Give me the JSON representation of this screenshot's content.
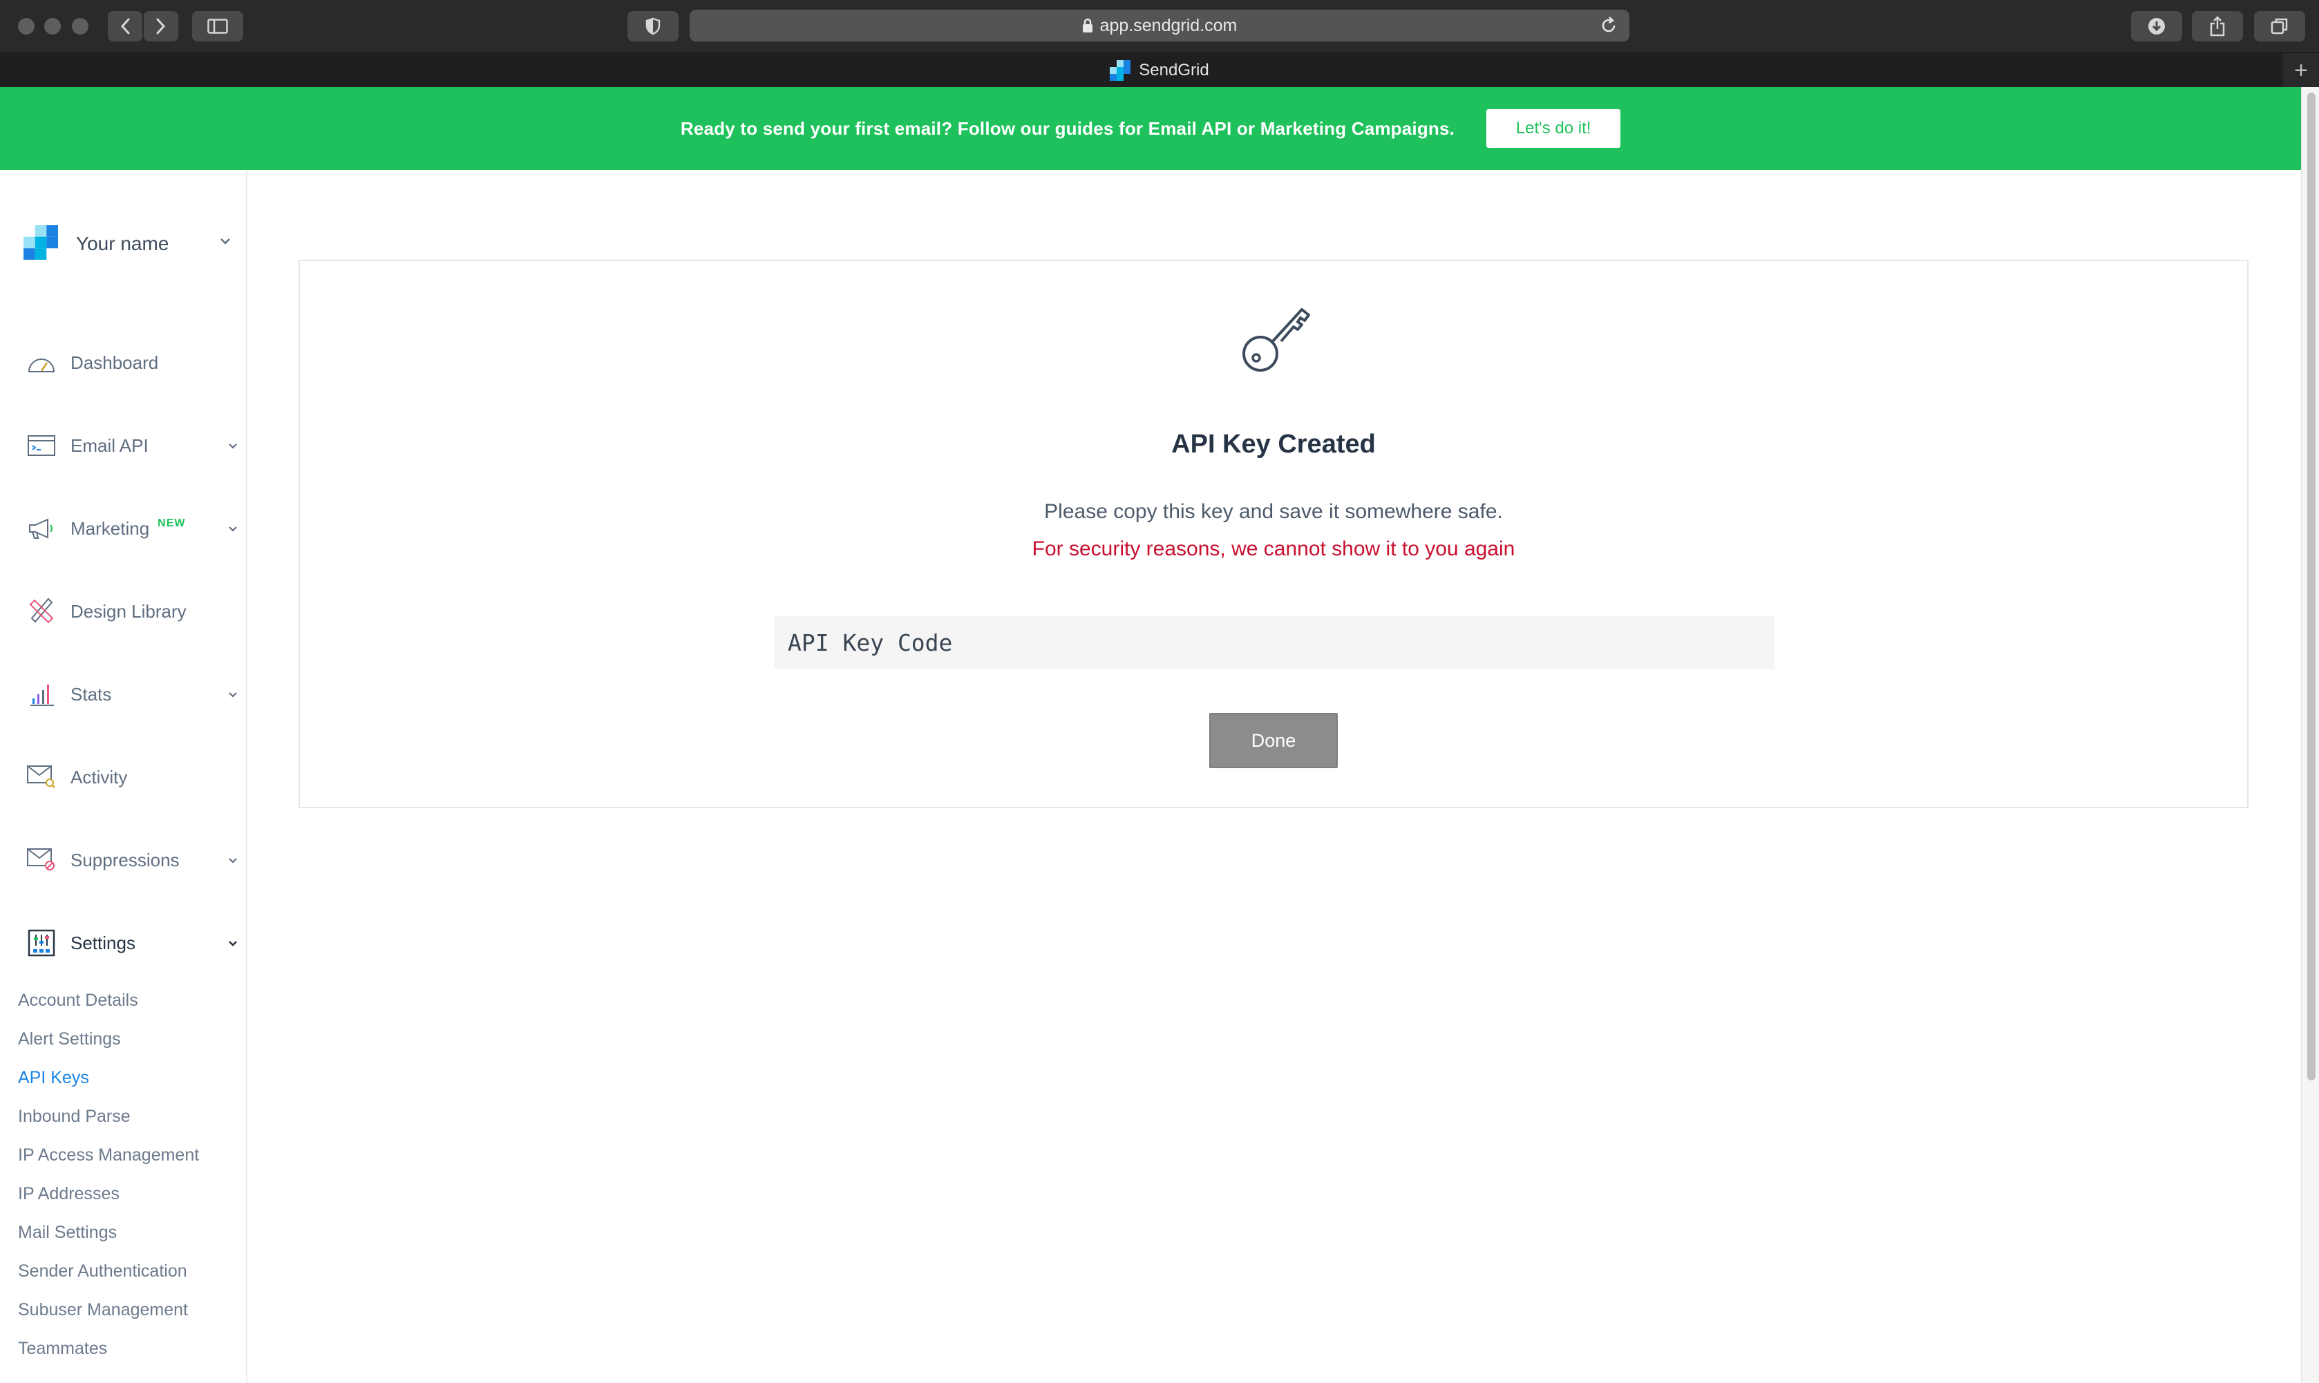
{
  "browser": {
    "url": "app.sendgrid.com",
    "tab_title": "SendGrid"
  },
  "banner": {
    "text": "Ready to send your first email? Follow our guides for Email API or Marketing Campaigns.",
    "button": "Let's do it!"
  },
  "sidebar": {
    "account_name": "Your name",
    "nav": [
      {
        "label": "Dashboard"
      },
      {
        "label": "Email API"
      },
      {
        "label": "Marketing",
        "badge": "NEW"
      },
      {
        "label": "Design Library"
      },
      {
        "label": "Stats"
      },
      {
        "label": "Activity"
      },
      {
        "label": "Suppressions"
      },
      {
        "label": "Settings"
      }
    ],
    "settings_items": [
      "Account Details",
      "Alert Settings",
      "API Keys",
      "Inbound Parse",
      "IP Access Management",
      "IP Addresses",
      "Mail Settings",
      "Sender Authentication",
      "Subuser Management",
      "Teammates"
    ]
  },
  "card": {
    "title": "API Key Created",
    "message": "Please copy this key and save it somewhere safe.",
    "warning": "For security reasons, we cannot show it to you again",
    "key_value": "API Key Code",
    "done_button": "Done"
  },
  "colors": {
    "banner_green": "#1ec15b",
    "warning_red": "#c8102e",
    "active_link_blue": "#1a82e2"
  }
}
